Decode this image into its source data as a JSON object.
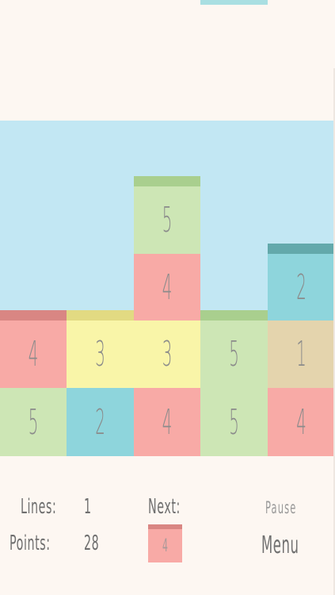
{
  "colors": {
    "background": "#fdf7f2",
    "sky": "#c2e7f3",
    "pink": "#f8aaa6",
    "pink_cap": "#d98683",
    "green": "#cde6b5",
    "green_cap": "#a9cf8e",
    "yellow": "#f9f5a8",
    "yellow_cap": "#e2da82",
    "blue": "#8ed5dc",
    "blue_cap": "#63a9ab",
    "tan": "#e4d4ad"
  },
  "board": {
    "columns": 5,
    "rows": [
      [
        null,
        null,
        {
          "value": "5",
          "color": "green",
          "cap": true
        },
        null,
        null
      ],
      [
        null,
        null,
        {
          "value": "4",
          "color": "pink"
        },
        null,
        {
          "value": "2",
          "color": "blue",
          "cap": true
        }
      ],
      [
        {
          "value": "4",
          "color": "pink",
          "cap": true
        },
        {
          "value": "3",
          "color": "yellow",
          "cap": true
        },
        {
          "value": "3",
          "color": "yellow"
        },
        {
          "value": "5",
          "color": "green",
          "cap": true
        },
        {
          "value": "1",
          "color": "tan"
        }
      ],
      [
        {
          "value": "5",
          "color": "green"
        },
        {
          "value": "2",
          "color": "blue"
        },
        {
          "value": "4",
          "color": "pink"
        },
        {
          "value": "5",
          "color": "green"
        },
        {
          "value": "4",
          "color": "pink"
        }
      ]
    ]
  },
  "hud": {
    "lines_label": "Lines:",
    "lines_value": "1",
    "points_label": "Points:",
    "points_value": "28",
    "next_label": "Next:",
    "next_value": "4",
    "next_color": "pink",
    "pause_label": "Pause",
    "menu_label": "Menu"
  }
}
